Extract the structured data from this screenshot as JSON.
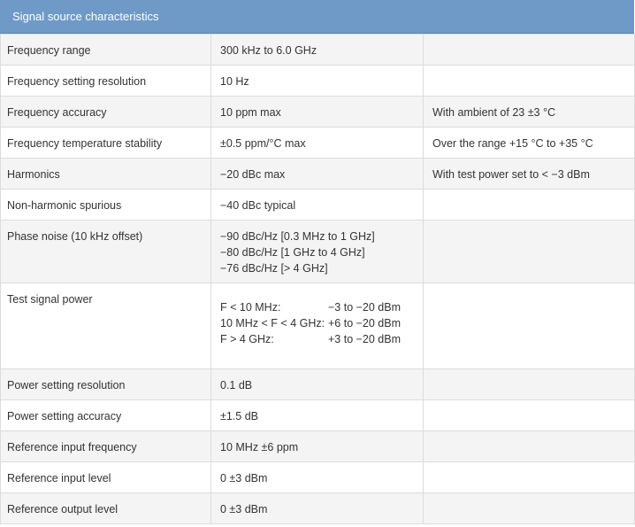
{
  "header": {
    "title": "Signal source characteristics"
  },
  "rows": [
    {
      "label": "Frequency range",
      "value": "300 kHz to 6.0 GHz",
      "note": ""
    },
    {
      "label": "Frequency setting resolution",
      "value": "10 Hz",
      "note": ""
    },
    {
      "label": "Frequency accuracy",
      "value": "10 ppm max",
      "note": "With ambient of 23 ±3 °C"
    },
    {
      "label": "Frequency temperature stability",
      "value": "±0.5 ppm/°C max",
      "note": "Over the range +15 °C to +35 °C"
    },
    {
      "label": "Harmonics",
      "value": "−20 dBc max",
      "note": "With test power set to < −3 dBm"
    },
    {
      "label": "Non-harmonic spurious",
      "value": "−40 dBc typical",
      "note": ""
    },
    {
      "label": "Phase noise (10 kHz offset)",
      "lines": [
        "−90 dBc/Hz [0.3 MHz to 1 GHz]",
        "−80 dBc/Hz [1 GHz to 4 GHz]",
        "−76 dBc/Hz [> 4 GHz]"
      ],
      "note": ""
    },
    {
      "label": "Test signal power",
      "pairs": [
        {
          "k": "F < 10 MHz:",
          "v": "−3 to −20 dBm"
        },
        {
          "k": "10 MHz < F < 4 GHz:",
          "v": "+6 to −20 dBm"
        },
        {
          "k": "F > 4 GHz:",
          "v": "+3 to −20 dBm"
        }
      ],
      "note": ""
    },
    {
      "label": "Power setting resolution",
      "value": "0.1 dB",
      "note": ""
    },
    {
      "label": "Power setting accuracy",
      "value": "±1.5 dB",
      "note": ""
    },
    {
      "label": "Reference input frequency",
      "value": "10 MHz ±6 ppm",
      "note": ""
    },
    {
      "label": "Reference input level",
      "value": "0 ±3 dBm",
      "note": ""
    },
    {
      "label": "Reference output level",
      "value": "0 ±3 dBm",
      "note": ""
    }
  ]
}
